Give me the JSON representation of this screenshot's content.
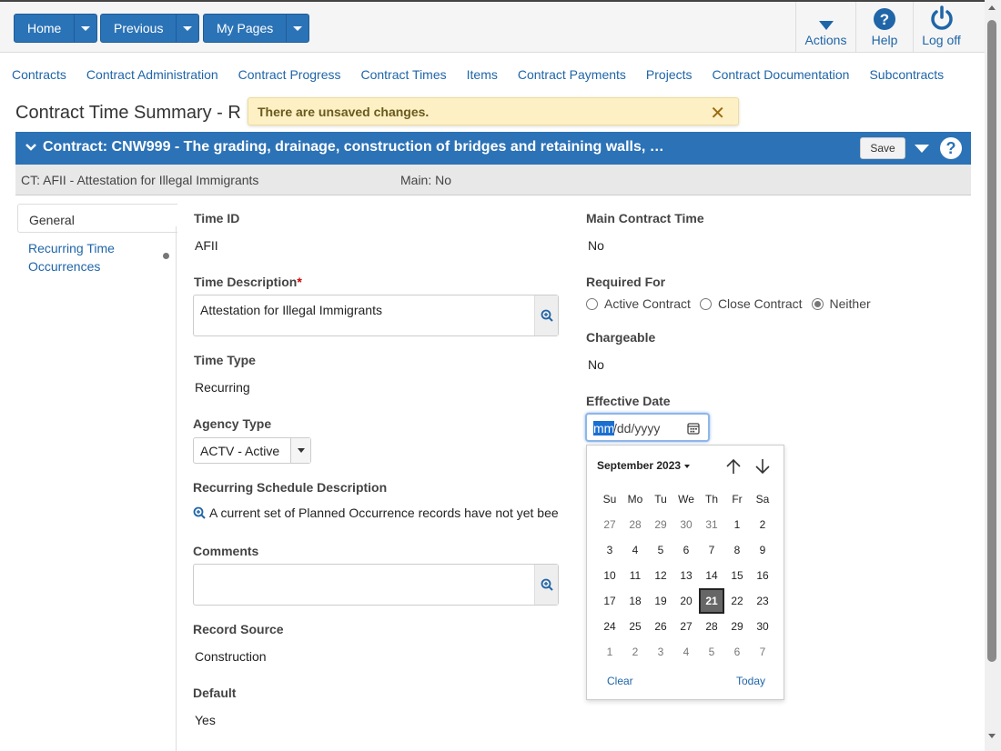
{
  "topbar": {
    "buttons": [
      {
        "label": "Home"
      },
      {
        "label": "Previous"
      },
      {
        "label": "My Pages"
      }
    ],
    "tools": [
      {
        "label": "Actions",
        "icon": "caret-down-icon"
      },
      {
        "label": "Help",
        "icon": "question-circle-icon"
      },
      {
        "label": "Log off",
        "icon": "power-icon"
      }
    ]
  },
  "nav": [
    "Contracts",
    "Contract Administration",
    "Contract Progress",
    "Contract Times",
    "Items",
    "Contract Payments",
    "Projects",
    "Contract Documentation",
    "Subcontracts"
  ],
  "page_title": "Contract Time Summary - R",
  "toast": {
    "message": "There are unsaved changes.",
    "close": "✕"
  },
  "contract": {
    "title": "Contract: CNW999 - The grading, drainage, construction of bridges and retaining walls, …",
    "save_label": "Save",
    "help": "?",
    "sub_ct": "CT: AFII - Attestation for Illegal Immigrants",
    "sub_main": "Main: No"
  },
  "tabs": {
    "general": "General",
    "recurring": "Recurring Time Occurrences"
  },
  "fields": {
    "time_id": {
      "label": "Time ID",
      "value": "AFII"
    },
    "time_description": {
      "label": "Time Description",
      "required": "*",
      "value": "Attestation for Illegal Immigrants"
    },
    "time_type": {
      "label": "Time Type",
      "value": "Recurring"
    },
    "agency_type": {
      "label": "Agency Type",
      "value": "ACTV - Active"
    },
    "recurring_schedule": {
      "label": "Recurring Schedule Description",
      "value": "A current set of Planned Occurrence records have not yet bee"
    },
    "comments": {
      "label": "Comments",
      "value": ""
    },
    "record_source": {
      "label": "Record Source",
      "value": "Construction"
    },
    "default": {
      "label": "Default",
      "value": "Yes"
    },
    "main_contract_time": {
      "label": "Main Contract Time",
      "value": "No"
    },
    "required_for": {
      "label": "Required For",
      "options": [
        "Active Contract",
        "Close Contract",
        "Neither"
      ],
      "selected": "Neither"
    },
    "chargeable": {
      "label": "Chargeable",
      "value": "No"
    },
    "effective_date": {
      "label": "Effective Date",
      "mm": "mm",
      "rest": "/dd/yyyy"
    }
  },
  "calendar": {
    "month": "September 2023",
    "weekdays": [
      "Su",
      "Mo",
      "Tu",
      "We",
      "Th",
      "Fr",
      "Sa"
    ],
    "weeks": [
      [
        "27",
        "28",
        "29",
        "30",
        "31",
        "1",
        "2"
      ],
      [
        "3",
        "4",
        "5",
        "6",
        "7",
        "8",
        "9"
      ],
      [
        "10",
        "11",
        "12",
        "13",
        "14",
        "15",
        "16"
      ],
      [
        "17",
        "18",
        "19",
        "20",
        "21",
        "22",
        "23"
      ],
      [
        "24",
        "25",
        "26",
        "27",
        "28",
        "29",
        "30"
      ],
      [
        "1",
        "2",
        "3",
        "4",
        "5",
        "6",
        "7"
      ]
    ],
    "today": "21",
    "clear_label": "Clear",
    "today_label": "Today"
  },
  "colors": {
    "accent": "#2c72b6",
    "link": "#1f65a8",
    "toast_bg": "#fdf0c4"
  }
}
